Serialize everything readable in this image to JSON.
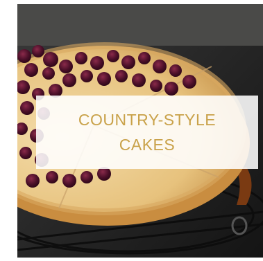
{
  "card": {
    "title_line1": "COUNTRY-STYLE",
    "title_line2": "CAKES",
    "accent_color": "#c9a24a",
    "image_subject": "cherry-cheesecake-photo"
  }
}
